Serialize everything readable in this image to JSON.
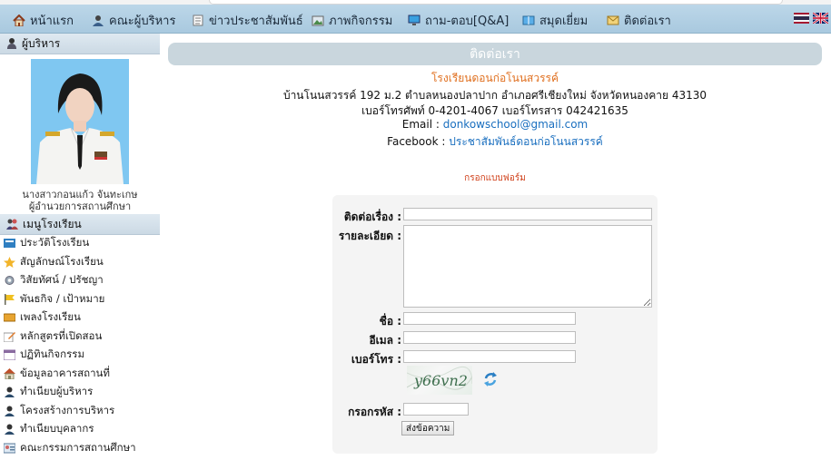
{
  "nav": {
    "items": [
      {
        "label": "หน้าแรก",
        "icon": "home-icon"
      },
      {
        "label": "คณะผู้บริหาร",
        "icon": "people-icon"
      },
      {
        "label": "ข่าวประชาสัมพันธ์",
        "icon": "news-icon"
      },
      {
        "label": "ภาพกิจกรรม",
        "icon": "photo-icon"
      },
      {
        "label": "ถาม-ตอบ[Q&A]",
        "icon": "monitor-icon"
      },
      {
        "label": "สมุดเยี่ยม",
        "icon": "book-icon"
      },
      {
        "label": "ติดต่อเรา",
        "icon": "mail-icon"
      }
    ],
    "flags": [
      "thai-flag-icon",
      "uk-flag-icon"
    ]
  },
  "sidebar": {
    "admin_title": "ผู้บริหาร",
    "admin_name": "นางสาวกอนแก้ว จันทะเกษ",
    "admin_position": "ผู้อำนวยการสถานศึกษา",
    "menu_title": "เมนูโรงเรียน",
    "menu_items": [
      {
        "label": "ประวัติโรงเรียน",
        "icon": "history-icon"
      },
      {
        "label": "สัญลักษณ์โรงเรียน",
        "icon": "star-icon"
      },
      {
        "label": "วิสัยทัศน์ / ปรัชญา",
        "icon": "gear-icon"
      },
      {
        "label": "พันธกิจ / เป้าหมาย",
        "icon": "flag-icon"
      },
      {
        "label": "เพลงโรงเรียน",
        "icon": "music-icon"
      },
      {
        "label": "หลักสูตรที่เปิดสอน",
        "icon": "edit-icon"
      },
      {
        "label": "ปฏิทินกิจกรรม",
        "icon": "calendar-icon"
      },
      {
        "label": "ข้อมูลอาคารสถานที่",
        "icon": "building-icon"
      },
      {
        "label": "ทำเนียบผู้บริหาร",
        "icon": "person-icon"
      },
      {
        "label": "โครงสร้างการบริหาร",
        "icon": "person-icon"
      },
      {
        "label": "ทำเนียบบุคลากร",
        "icon": "person-icon"
      },
      {
        "label": "คณะกรรมการสถานศึกษา",
        "icon": "committee-icon"
      }
    ]
  },
  "contact": {
    "header": "ติดต่อเรา",
    "school_name": "โรงเรียนดอนก่อโนนสวรรค์",
    "address": "บ้านโนนสวรรค์ 192 ม.2   ตำบลหนองปลาปาก  อำเภอศรีเชียงใหม่ จังหวัดหนองคาย 43130",
    "phone": "เบอร์โทรศัพท์ 0-4201-4067 เบอร์โทรสาร 042421635",
    "email_label": "Email :",
    "email": "donkowschool@gmail.com",
    "facebook_label": "Facebook :",
    "facebook": "ประชาสัมพันธ์ดอนก่อโนนสวรรค์"
  },
  "form": {
    "title": "กรอกแบบฟอร์ม",
    "subject_label": "ติดต่อเรื่อง :",
    "subject_value": "",
    "details_label": "รายละเอียด :",
    "details_value": "",
    "name_label": "ชื่อ :",
    "name_value": "",
    "email_label": "อีเมล :",
    "email_value": "",
    "phone_label": "เบอร์โทร :",
    "phone_value": "",
    "captcha_text": "y66vn2",
    "code_label": "กรอกรหัส :",
    "code_value": "",
    "submit_label": "ส่งข้อความ"
  },
  "colors": {
    "nav_bg": "#b4d0e3",
    "contact_bar": "#c9d6dd",
    "school_name": "#e07020",
    "link": "#1a6fbf",
    "form_title": "#d0401a"
  }
}
